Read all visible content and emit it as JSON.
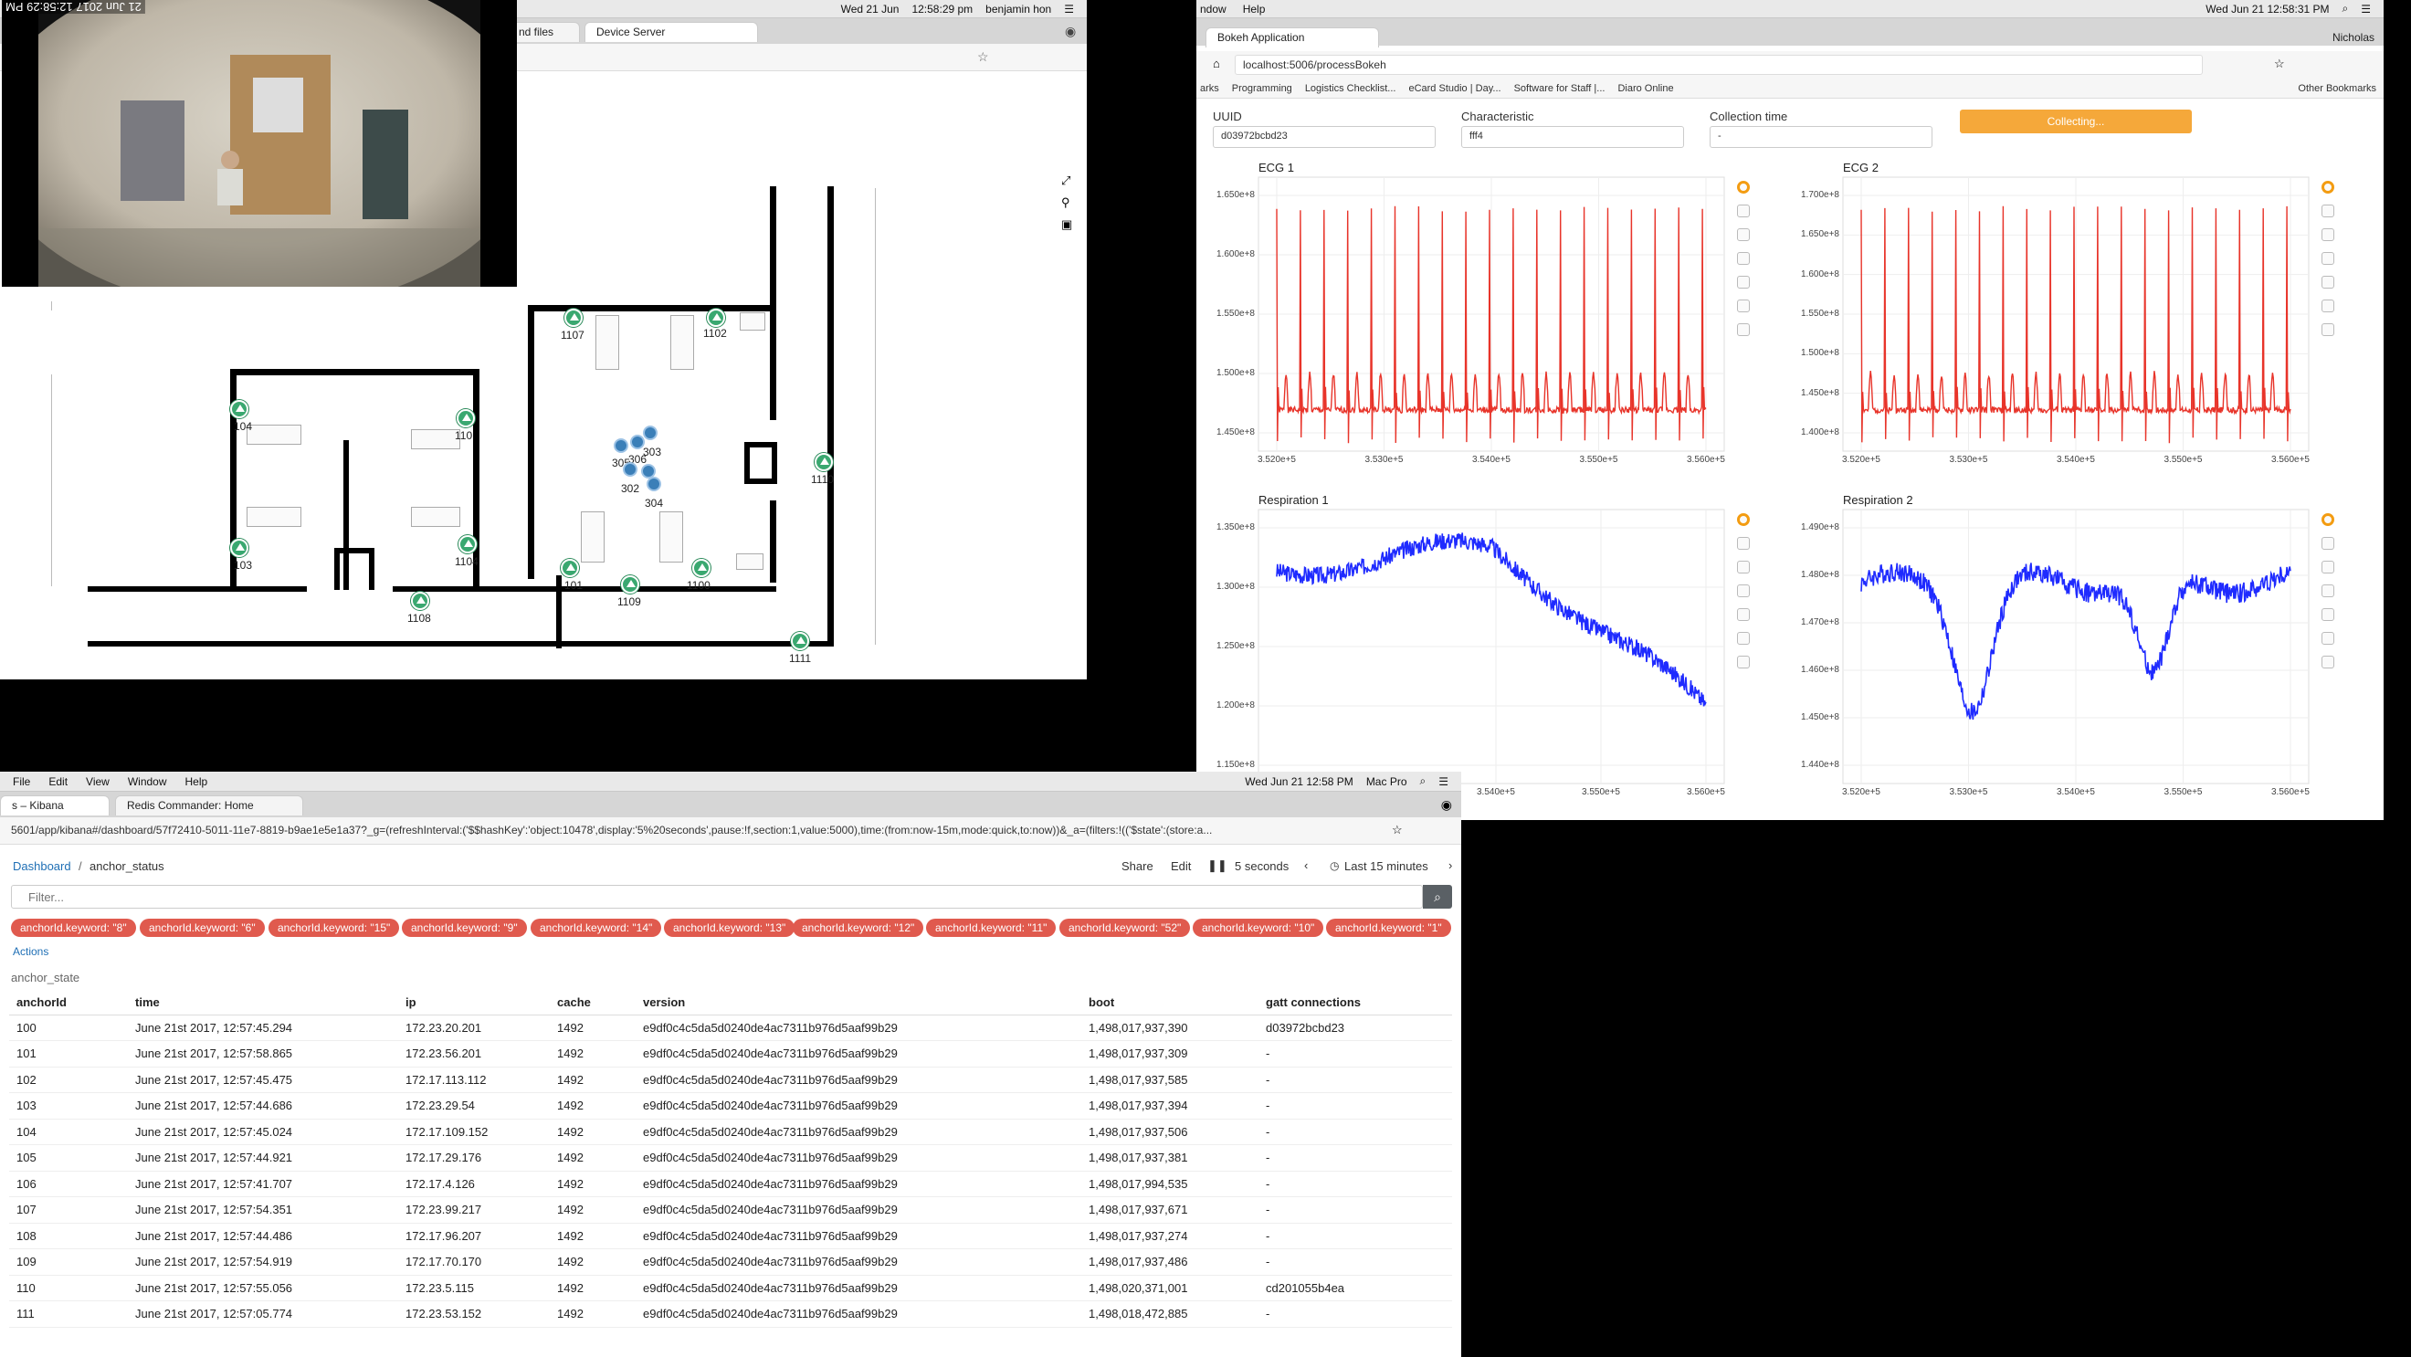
{
  "floor_window": {
    "menubar": {
      "date": "Wed 21 Jun",
      "time": "12:58:29 pm",
      "user": "benjamin hon",
      "left_fragment": "21 Jun 2017",
      "left_time": "12:58:29 PM"
    },
    "tabs": [
      {
        "label": "nd files"
      },
      {
        "label": "Device Server"
      }
    ],
    "anchors": [
      {
        "id": "1107"
      },
      {
        "id": "1102"
      },
      {
        "id": "104"
      },
      {
        "id": "110"
      },
      {
        "id": "1110"
      },
      {
        "id": "103"
      },
      {
        "id": "1104"
      },
      {
        "id": "101"
      },
      {
        "id": "1100"
      },
      {
        "id": "1109"
      },
      {
        "id": "1108"
      },
      {
        "id": "1111"
      }
    ],
    "tags": [
      {
        "id": "303"
      },
      {
        "id": "306"
      },
      {
        "id": "305"
      },
      {
        "id": "302"
      },
      {
        "id": "304"
      },
      {
        "id": "303"
      }
    ]
  },
  "bokeh_window": {
    "menubar": {
      "menu_left": "ndow",
      "menu_help": "Help",
      "datetime": "Wed Jun 21  12:58:31 PM",
      "user": "Nicholas"
    },
    "tab_label": "Bokeh Application",
    "url": "localhost:5006/processBokeh",
    "bookmarks": [
      "arks",
      "Programming",
      "Logistics Checklist...",
      "eCard Studio | Day...",
      "Software for Staff |...",
      "Diaro Online"
    ],
    "other_bookmarks": "Other Bookmarks",
    "controls": {
      "uuid_label": "UUID",
      "uuid_value": "d03972bcbd23",
      "char_label": "Characteristic",
      "char_value": "fff4",
      "time_label": "Collection time",
      "time_value": "-",
      "button_label": "Collecting..."
    },
    "plots": [
      {
        "title": "ECG 1",
        "yticks": [
          "1.650e+8",
          "1.600e+8",
          "1.550e+8",
          "1.500e+8",
          "1.450e+8"
        ],
        "xticks": [
          "3.520e+5",
          "3.530e+5",
          "3.540e+5",
          "3.550e+5",
          "3.560e+5"
        ]
      },
      {
        "title": "ECG 2",
        "yticks": [
          "1.700e+8",
          "1.650e+8",
          "1.600e+8",
          "1.550e+8",
          "1.500e+8",
          "1.450e+8",
          "1.400e+8"
        ],
        "xticks": [
          "3.520e+5",
          "3.530e+5",
          "3.540e+5",
          "3.550e+5",
          "3.560e+5"
        ]
      },
      {
        "title": "Respiration 1",
        "yticks": [
          "1.350e+8",
          "1.300e+8",
          "1.250e+8",
          "1.200e+8",
          "1.150e+8"
        ],
        "xticks": [
          "3.540e+5",
          "3.550e+5",
          "3.560e+5"
        ]
      },
      {
        "title": "Respiration 2",
        "yticks": [
          "1.490e+8",
          "1.480e+8",
          "1.470e+8",
          "1.460e+8",
          "1.450e+8",
          "1.440e+8"
        ],
        "xticks": [
          "3.520e+5",
          "3.530e+5",
          "3.540e+5",
          "3.550e+5",
          "3.560e+5"
        ]
      }
    ]
  },
  "kibana_window": {
    "menubar": {
      "menus": [
        "File",
        "Edit",
        "View",
        "Window",
        "Help"
      ],
      "datetime": "Wed Jun 21  12:58 PM",
      "machine": "Mac Pro"
    },
    "tabs": [
      {
        "label": "s – Kibana"
      },
      {
        "label": "Redis Commander: Home"
      }
    ],
    "url": "5601/app/kibana#/dashboard/57f72410-5011-11e7-8819-b9ae1e5e1a37?_g=(refreshInterval:('$$hashKey':'object:10478',display:'5%20seconds',pause:!f,section:1,value:5000),time:(from:now-15m,mode:quick,to:now))&_a=(filters:!(('$state':(store:a...",
    "breadcrumb": {
      "root": "Dashboard",
      "current": "anchor_status"
    },
    "toolbar": {
      "share": "Share",
      "edit": "Edit",
      "interval": "5 seconds",
      "range": "Last 15 minutes"
    },
    "filter_placeholder": "Filter...",
    "filters": [
      "anchorId.keyword: \"8\"",
      "anchorId.keyword: \"6\"",
      "anchorId.keyword: \"15\"",
      "anchorId.keyword: \"9\"",
      "anchorId.keyword: \"14\"",
      "anchorId.keyword: \"13\"",
      "anchorId.keyword: \"12\"",
      "anchorId.keyword: \"11\"",
      "anchorId.keyword: \"52\"",
      "anchorId.keyword: \"10\"",
      "anchorId.keyword: \"1\""
    ],
    "actions_label": "Actions",
    "panel_title": "anchor_state",
    "columns": [
      "anchorId",
      "time",
      "ip",
      "cache",
      "version",
      "boot",
      "gatt connections"
    ],
    "rows": [
      [
        "100",
        "June 21st 2017, 12:57:45.294",
        "172.23.20.201",
        "1492",
        "e9df0c4c5da5d0240de4ac7311b976d5aaf99b29",
        "1,498,017,937,390",
        "d03972bcbd23"
      ],
      [
        "101",
        "June 21st 2017, 12:57:58.865",
        "172.23.56.201",
        "1492",
        "e9df0c4c5da5d0240de4ac7311b976d5aaf99b29",
        "1,498,017,937,309",
        "-"
      ],
      [
        "102",
        "June 21st 2017, 12:57:45.475",
        "172.17.113.112",
        "1492",
        "e9df0c4c5da5d0240de4ac7311b976d5aaf99b29",
        "1,498,017,937,585",
        "-"
      ],
      [
        "103",
        "June 21st 2017, 12:57:44.686",
        "172.23.29.54",
        "1492",
        "e9df0c4c5da5d0240de4ac7311b976d5aaf99b29",
        "1,498,017,937,394",
        "-"
      ],
      [
        "104",
        "June 21st 2017, 12:57:45.024",
        "172.17.109.152",
        "1492",
        "e9df0c4c5da5d0240de4ac7311b976d5aaf99b29",
        "1,498,017,937,506",
        "-"
      ],
      [
        "105",
        "June 21st 2017, 12:57:44.921",
        "172.17.29.176",
        "1492",
        "e9df0c4c5da5d0240de4ac7311b976d5aaf99b29",
        "1,498,017,937,381",
        "-"
      ],
      [
        "106",
        "June 21st 2017, 12:57:41.707",
        "172.17.4.126",
        "1492",
        "e9df0c4c5da5d0240de4ac7311b976d5aaf99b29",
        "1,498,017,994,535",
        "-"
      ],
      [
        "107",
        "June 21st 2017, 12:57:54.351",
        "172.23.99.217",
        "1492",
        "e9df0c4c5da5d0240de4ac7311b976d5aaf99b29",
        "1,498,017,937,671",
        "-"
      ],
      [
        "108",
        "June 21st 2017, 12:57:44.486",
        "172.17.96.207",
        "1492",
        "e9df0c4c5da5d0240de4ac7311b976d5aaf99b29",
        "1,498,017,937,274",
        "-"
      ],
      [
        "109",
        "June 21st 2017, 12:57:54.919",
        "172.17.70.170",
        "1492",
        "e9df0c4c5da5d0240de4ac7311b976d5aaf99b29",
        "1,498,017,937,486",
        "-"
      ],
      [
        "110",
        "June 21st 2017, 12:57:55.056",
        "172.23.5.115",
        "1492",
        "e9df0c4c5da5d0240de4ac7311b976d5aaf99b29",
        "1,498,020,371,001",
        "cd201055b4ea"
      ],
      [
        "111",
        "June 21st 2017, 12:57:05.774",
        "172.23.53.152",
        "1492",
        "e9df0c4c5da5d0240de4ac7311b976d5aaf99b29",
        "1,498,018,472,885",
        "-"
      ]
    ]
  },
  "colors": {
    "anchor": "#3aa870",
    "tag": "#3b7fb8",
    "ecg": "#e8342a",
    "resp": "#1f2bff",
    "pill": "#e05a4e",
    "collect": "#f5a83a",
    "kibana_link": "#1f6fb5"
  }
}
